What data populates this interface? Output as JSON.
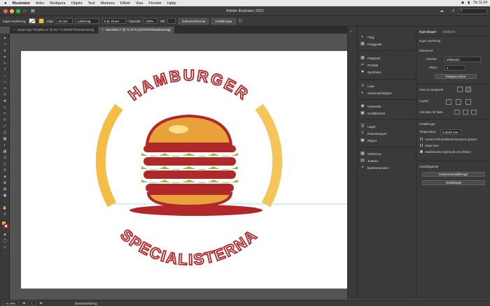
{
  "menubar": {
    "apple": "",
    "app": "Illustrator",
    "items": [
      "Arkiv",
      "Redigera",
      "Objekt",
      "Text",
      "Markera",
      "Effekt",
      "Visa",
      "Fönster",
      "Hjälp"
    ],
    "right": [
      "Tis 11:24"
    ]
  },
  "window": {
    "title": "Adobe Illustrator 2021"
  },
  "control": {
    "selection_label": "Ingen markering",
    "stroke_label": "Linje",
    "stroke_value": "15 mm",
    "stroke_style": "Likformig",
    "brush": "5 pt. Rund",
    "opacity_label": "Opacitet",
    "opacity_value": "100%",
    "style_label": "Stil",
    "doc_button": "Dokumentformat",
    "prefs_button": "Inställningar"
  },
  "tabs": [
    {
      "label": "burger logo Template.ai* @ 34,7 % (RGB/Förhandsvisning)",
      "close": "×"
    },
    {
      "label": "Namnlöst-1* @ 74,79 % (CMYK/Förhandsvisning)",
      "close": "×"
    }
  ],
  "logo": {
    "top_text": "HAMBURGER",
    "bottom_text": "SPECIALISTERNA",
    "colors": {
      "red": "#b0282a",
      "yellow": "#f4bd45",
      "green": "#8bbf4a",
      "bun": "#e9a239"
    }
  },
  "panels": {
    "group1": [
      "Färg",
      "Färgguide"
    ],
    "group2": [
      "Färgrutor",
      "Penslar",
      "Symboler"
    ],
    "group3": [
      "Linje",
      "Genomskinlighet"
    ],
    "group4": [
      "Utseende",
      "Grafikformer"
    ],
    "group5": [
      "Lager",
      "Resursexport",
      "Ritytor"
    ],
    "group6": [
      "Omforma",
      "Justera",
      "Banhanteraren"
    ]
  },
  "properties": {
    "tabs": [
      "Egenskaper",
      "Bibliotek"
    ],
    "no_selection": "Ingen markering",
    "document": "Dokument",
    "units_label": "Enheter:",
    "units_value": "Millimeter",
    "artboard_label": "Rityta:",
    "artboard_value": "1",
    "edit_artboards": "Redigera ritytor",
    "snap_label": "Fäst vid stödpunkt",
    "rulers_label": "Linjaler",
    "align_label": "Alternativ för fästa",
    "prefs_section": "Inställningar",
    "key_increment_label": "Tangentsteg:",
    "key_increment_value": "0,3528 mm",
    "check1": "Använd förhandsbeskrivningens gränser",
    "check2": "Skala hörn",
    "check3": "Skalförändra linjebredd och effekter",
    "quick_actions": "Snabbåtgärder",
    "doc_settings_button": "Dokumentinställningar",
    "preferences_button": "Inställningar"
  },
  "status": {
    "zoom": "74,79%",
    "page": "1",
    "tool": "Direktmarkering"
  }
}
